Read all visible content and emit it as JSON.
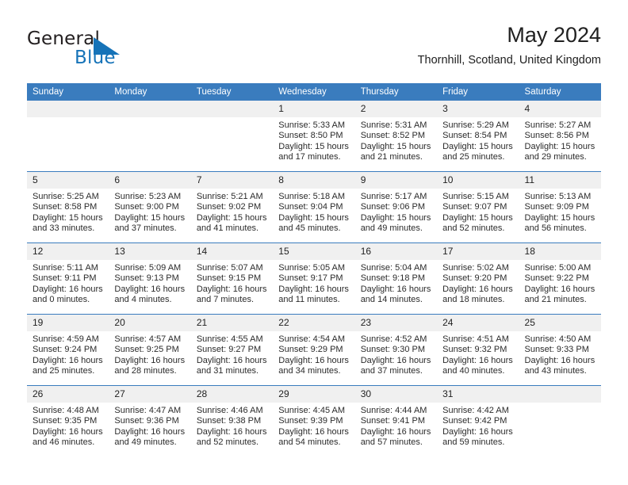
{
  "brand": {
    "name_part1": "General",
    "name_part2": "Blue",
    "logo_icon": "triangle-logo-icon",
    "accent_color": "#1673b8"
  },
  "header": {
    "title": "May 2024",
    "subtitle": "Thornhill, Scotland, United Kingdom"
  },
  "calendar": {
    "header_background": "#3a7cbe",
    "daynum_background": "#f0f0f0",
    "weekday_headers": [
      "Sunday",
      "Monday",
      "Tuesday",
      "Wednesday",
      "Thursday",
      "Friday",
      "Saturday"
    ],
    "weeks": [
      [
        {
          "day": "",
          "empty": true
        },
        {
          "day": "",
          "empty": true
        },
        {
          "day": "",
          "empty": true
        },
        {
          "day": "1",
          "sunrise": "Sunrise: 5:33 AM",
          "sunset": "Sunset: 8:50 PM",
          "daylight_line1": "Daylight: 15 hours",
          "daylight_line2": "and 17 minutes."
        },
        {
          "day": "2",
          "sunrise": "Sunrise: 5:31 AM",
          "sunset": "Sunset: 8:52 PM",
          "daylight_line1": "Daylight: 15 hours",
          "daylight_line2": "and 21 minutes."
        },
        {
          "day": "3",
          "sunrise": "Sunrise: 5:29 AM",
          "sunset": "Sunset: 8:54 PM",
          "daylight_line1": "Daylight: 15 hours",
          "daylight_line2": "and 25 minutes."
        },
        {
          "day": "4",
          "sunrise": "Sunrise: 5:27 AM",
          "sunset": "Sunset: 8:56 PM",
          "daylight_line1": "Daylight: 15 hours",
          "daylight_line2": "and 29 minutes."
        }
      ],
      [
        {
          "day": "5",
          "sunrise": "Sunrise: 5:25 AM",
          "sunset": "Sunset: 8:58 PM",
          "daylight_line1": "Daylight: 15 hours",
          "daylight_line2": "and 33 minutes."
        },
        {
          "day": "6",
          "sunrise": "Sunrise: 5:23 AM",
          "sunset": "Sunset: 9:00 PM",
          "daylight_line1": "Daylight: 15 hours",
          "daylight_line2": "and 37 minutes."
        },
        {
          "day": "7",
          "sunrise": "Sunrise: 5:21 AM",
          "sunset": "Sunset: 9:02 PM",
          "daylight_line1": "Daylight: 15 hours",
          "daylight_line2": "and 41 minutes."
        },
        {
          "day": "8",
          "sunrise": "Sunrise: 5:18 AM",
          "sunset": "Sunset: 9:04 PM",
          "daylight_line1": "Daylight: 15 hours",
          "daylight_line2": "and 45 minutes."
        },
        {
          "day": "9",
          "sunrise": "Sunrise: 5:17 AM",
          "sunset": "Sunset: 9:06 PM",
          "daylight_line1": "Daylight: 15 hours",
          "daylight_line2": "and 49 minutes."
        },
        {
          "day": "10",
          "sunrise": "Sunrise: 5:15 AM",
          "sunset": "Sunset: 9:07 PM",
          "daylight_line1": "Daylight: 15 hours",
          "daylight_line2": "and 52 minutes."
        },
        {
          "day": "11",
          "sunrise": "Sunrise: 5:13 AM",
          "sunset": "Sunset: 9:09 PM",
          "daylight_line1": "Daylight: 15 hours",
          "daylight_line2": "and 56 minutes."
        }
      ],
      [
        {
          "day": "12",
          "sunrise": "Sunrise: 5:11 AM",
          "sunset": "Sunset: 9:11 PM",
          "daylight_line1": "Daylight: 16 hours",
          "daylight_line2": "and 0 minutes."
        },
        {
          "day": "13",
          "sunrise": "Sunrise: 5:09 AM",
          "sunset": "Sunset: 9:13 PM",
          "daylight_line1": "Daylight: 16 hours",
          "daylight_line2": "and 4 minutes."
        },
        {
          "day": "14",
          "sunrise": "Sunrise: 5:07 AM",
          "sunset": "Sunset: 9:15 PM",
          "daylight_line1": "Daylight: 16 hours",
          "daylight_line2": "and 7 minutes."
        },
        {
          "day": "15",
          "sunrise": "Sunrise: 5:05 AM",
          "sunset": "Sunset: 9:17 PM",
          "daylight_line1": "Daylight: 16 hours",
          "daylight_line2": "and 11 minutes."
        },
        {
          "day": "16",
          "sunrise": "Sunrise: 5:04 AM",
          "sunset": "Sunset: 9:18 PM",
          "daylight_line1": "Daylight: 16 hours",
          "daylight_line2": "and 14 minutes."
        },
        {
          "day": "17",
          "sunrise": "Sunrise: 5:02 AM",
          "sunset": "Sunset: 9:20 PM",
          "daylight_line1": "Daylight: 16 hours",
          "daylight_line2": "and 18 minutes."
        },
        {
          "day": "18",
          "sunrise": "Sunrise: 5:00 AM",
          "sunset": "Sunset: 9:22 PM",
          "daylight_line1": "Daylight: 16 hours",
          "daylight_line2": "and 21 minutes."
        }
      ],
      [
        {
          "day": "19",
          "sunrise": "Sunrise: 4:59 AM",
          "sunset": "Sunset: 9:24 PM",
          "daylight_line1": "Daylight: 16 hours",
          "daylight_line2": "and 25 minutes."
        },
        {
          "day": "20",
          "sunrise": "Sunrise: 4:57 AM",
          "sunset": "Sunset: 9:25 PM",
          "daylight_line1": "Daylight: 16 hours",
          "daylight_line2": "and 28 minutes."
        },
        {
          "day": "21",
          "sunrise": "Sunrise: 4:55 AM",
          "sunset": "Sunset: 9:27 PM",
          "daylight_line1": "Daylight: 16 hours",
          "daylight_line2": "and 31 minutes."
        },
        {
          "day": "22",
          "sunrise": "Sunrise: 4:54 AM",
          "sunset": "Sunset: 9:29 PM",
          "daylight_line1": "Daylight: 16 hours",
          "daylight_line2": "and 34 minutes."
        },
        {
          "day": "23",
          "sunrise": "Sunrise: 4:52 AM",
          "sunset": "Sunset: 9:30 PM",
          "daylight_line1": "Daylight: 16 hours",
          "daylight_line2": "and 37 minutes."
        },
        {
          "day": "24",
          "sunrise": "Sunrise: 4:51 AM",
          "sunset": "Sunset: 9:32 PM",
          "daylight_line1": "Daylight: 16 hours",
          "daylight_line2": "and 40 minutes."
        },
        {
          "day": "25",
          "sunrise": "Sunrise: 4:50 AM",
          "sunset": "Sunset: 9:33 PM",
          "daylight_line1": "Daylight: 16 hours",
          "daylight_line2": "and 43 minutes."
        }
      ],
      [
        {
          "day": "26",
          "sunrise": "Sunrise: 4:48 AM",
          "sunset": "Sunset: 9:35 PM",
          "daylight_line1": "Daylight: 16 hours",
          "daylight_line2": "and 46 minutes."
        },
        {
          "day": "27",
          "sunrise": "Sunrise: 4:47 AM",
          "sunset": "Sunset: 9:36 PM",
          "daylight_line1": "Daylight: 16 hours",
          "daylight_line2": "and 49 minutes."
        },
        {
          "day": "28",
          "sunrise": "Sunrise: 4:46 AM",
          "sunset": "Sunset: 9:38 PM",
          "daylight_line1": "Daylight: 16 hours",
          "daylight_line2": "and 52 minutes."
        },
        {
          "day": "29",
          "sunrise": "Sunrise: 4:45 AM",
          "sunset": "Sunset: 9:39 PM",
          "daylight_line1": "Daylight: 16 hours",
          "daylight_line2": "and 54 minutes."
        },
        {
          "day": "30",
          "sunrise": "Sunrise: 4:44 AM",
          "sunset": "Sunset: 9:41 PM",
          "daylight_line1": "Daylight: 16 hours",
          "daylight_line2": "and 57 minutes."
        },
        {
          "day": "31",
          "sunrise": "Sunrise: 4:42 AM",
          "sunset": "Sunset: 9:42 PM",
          "daylight_line1": "Daylight: 16 hours",
          "daylight_line2": "and 59 minutes."
        },
        {
          "day": "",
          "empty": true
        }
      ]
    ]
  }
}
